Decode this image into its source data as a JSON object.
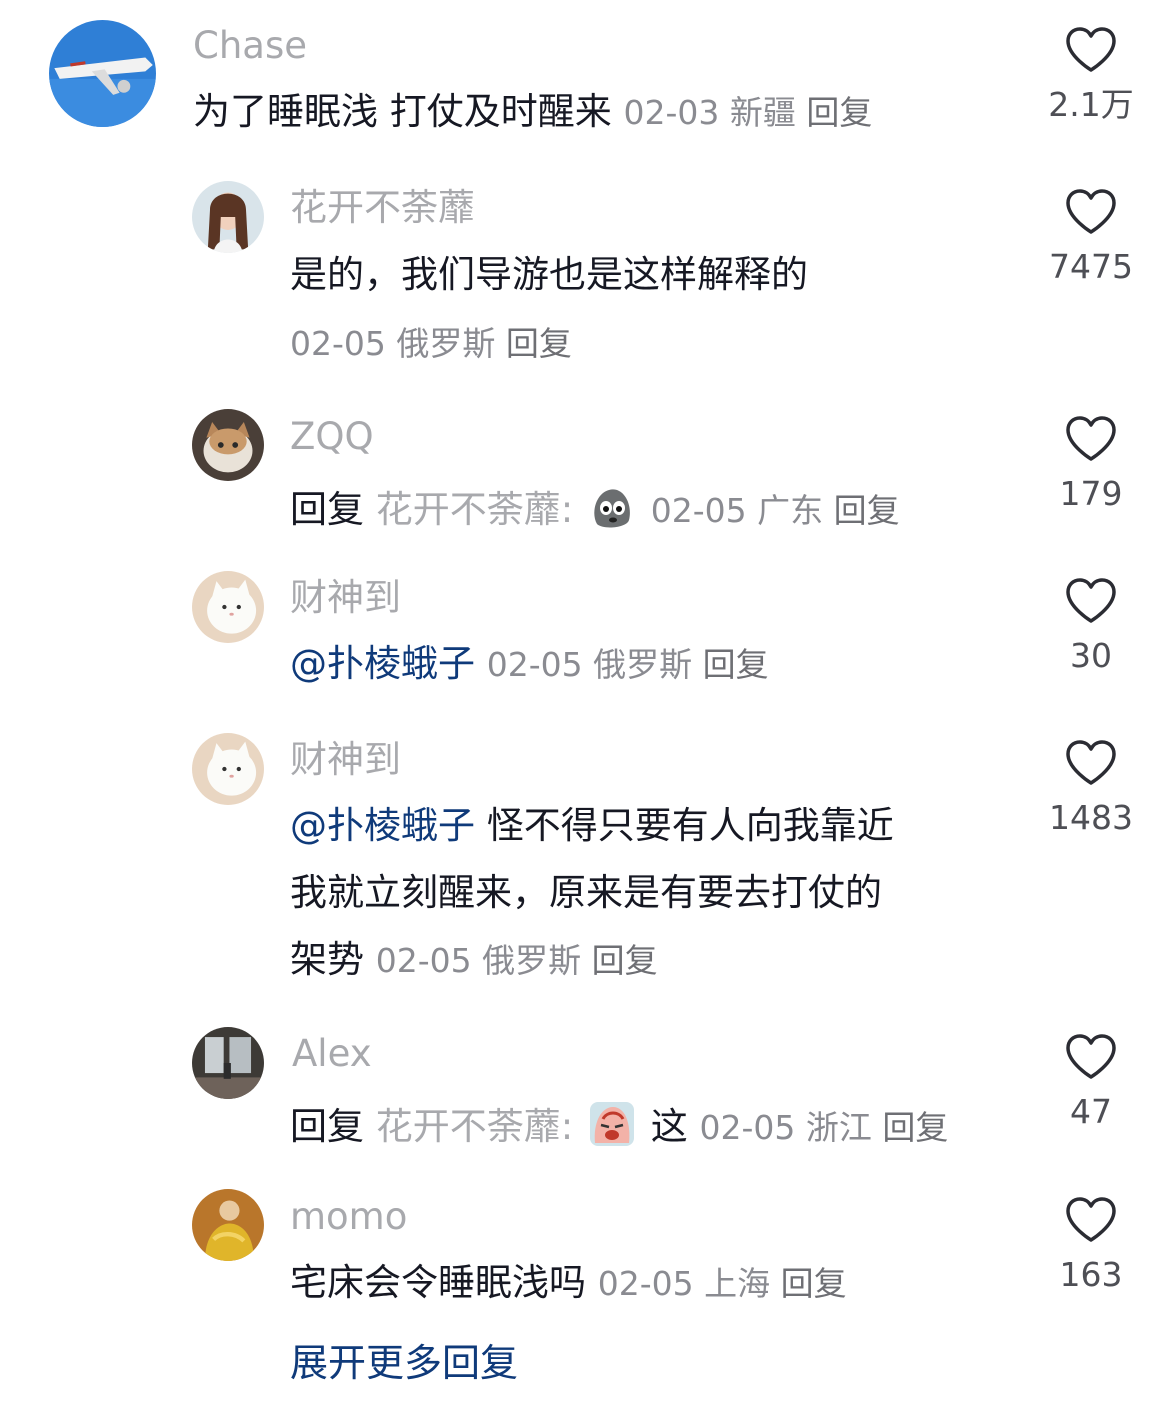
{
  "comments": [
    {
      "user": "Chase",
      "text": "为了睡眠浅 打仗及时醒来",
      "date": "02-03",
      "location": "新疆",
      "reply_label": "回复",
      "likes": "2.1万",
      "avatar_icon": "airplane-avatar"
    },
    {
      "user": "花开不荼蘼",
      "text": "是的，我们导游也是这样解释的",
      "date": "02-05",
      "location": "俄罗斯",
      "reply_label": "回复",
      "likes": "7475",
      "avatar_icon": "woman-avatar"
    },
    {
      "user": "ZQQ",
      "prefix": "回复",
      "quoted_user": "花开不荼蘼:",
      "emoji": "rock-face-emoji",
      "date": "02-05",
      "location": "广东",
      "reply_label": "回复",
      "likes": "179",
      "avatar_icon": "cat-avatar"
    },
    {
      "user": "财神到",
      "mention": "@扑棱蛾子",
      "date": "02-05",
      "location": "俄罗斯",
      "reply_label": "回复",
      "likes": "30",
      "avatar_icon": "white-cat-avatar"
    },
    {
      "user": "财神到",
      "mention": "@扑棱蛾子",
      "text_line1": "怪不得只要有人向我靠近",
      "text_line2": "我就立刻醒来，原来是有要去打仗的",
      "text_line3": "架势",
      "date": "02-05",
      "location": "俄罗斯",
      "reply_label": "回复",
      "likes": "1483",
      "avatar_icon": "white-cat-avatar"
    },
    {
      "user": "Alex",
      "prefix": "回复",
      "quoted_user": "花开不荼蘼:",
      "emoji": "crying-face-emoji",
      "text": "这",
      "date": "02-05",
      "location": "浙江",
      "reply_label": "回复",
      "likes": "47",
      "avatar_icon": "room-avatar"
    },
    {
      "user": "momo",
      "text": "宅床会令睡眠浅吗",
      "date": "02-05",
      "location": "上海",
      "reply_label": "回复",
      "likes": "163",
      "avatar_icon": "painting-avatar"
    }
  ],
  "expand_more": "展开更多回复",
  "colors": {
    "username": "#a8a9ad",
    "mention": "#0f3a7a",
    "meta": "#8a8b91"
  }
}
